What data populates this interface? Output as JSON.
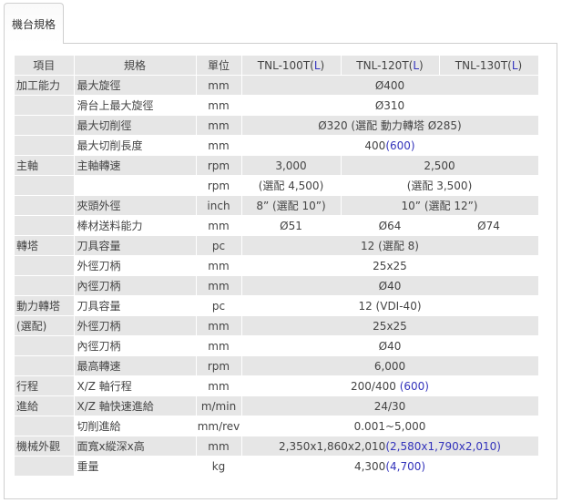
{
  "tab": {
    "label": "機台規格"
  },
  "header": {
    "item": "項目",
    "spec": "規格",
    "unit": "單位",
    "models": [
      {
        "name": "TNL-100T(",
        "accent": "L",
        "close": ")"
      },
      {
        "name": "TNL-120T(",
        "accent": "L",
        "close": ")"
      },
      {
        "name": "TNL-130T(",
        "accent": "L",
        "close": ")"
      }
    ]
  },
  "rows": {
    "r1": {
      "cat": "加工能力",
      "spec": "最大旋徑",
      "unit": "mm",
      "val": "Ø400"
    },
    "r2": {
      "spec": "滑台上最大旋徑",
      "unit": "mm",
      "val": "Ø310"
    },
    "r3": {
      "spec": "最大切削徑",
      "unit": "mm",
      "val": "Ø320 (選配 動力轉塔 Ø285)"
    },
    "r4": {
      "spec": "最大切削長度",
      "unit": "mm",
      "val": "400",
      "extra": "(600)"
    },
    "r5": {
      "cat": "主軸",
      "spec": "主軸轉速",
      "unit": "rpm",
      "v1": "3,000",
      "v23": "2,500"
    },
    "r6": {
      "unit": "rpm",
      "v1": "(選配 4,500)",
      "v23": "(選配 3,500)"
    },
    "r7": {
      "spec": "夾頭外徑",
      "unit": "inch",
      "v1": "8” (選配 10”)",
      "v23": "10” (選配 12”)"
    },
    "r8": {
      "spec": "棒材送料能力",
      "unit": "mm",
      "v1": "Ø51",
      "v2": "Ø64",
      "v3": "Ø74"
    },
    "r9": {
      "cat": "轉塔",
      "spec": "刀具容量",
      "unit": "pc",
      "val": "12 (選配 8)"
    },
    "r10": {
      "spec": "外徑刀柄",
      "unit": "mm",
      "val": "25x25"
    },
    "r11": {
      "spec": "內徑刀柄",
      "unit": "mm",
      "val": "Ø40"
    },
    "r12": {
      "cat": "動力轉塔",
      "spec": "刀具容量",
      "unit": "pc",
      "val": "12 (VDI-40)"
    },
    "r13": {
      "cat": "(選配)",
      "spec": "外徑刀柄",
      "unit": "mm",
      "val": "25x25"
    },
    "r14": {
      "spec": "內徑刀柄",
      "unit": "mm",
      "val": "Ø40"
    },
    "r15": {
      "spec": "最高轉速",
      "unit": "rpm",
      "val": "6,000"
    },
    "r16": {
      "cat": "行程",
      "spec": "X/Z 軸行程",
      "unit": "mm",
      "val": "200/400",
      "extra": "(600)"
    },
    "r17": {
      "cat": "進給",
      "spec": "X/Z 軸快速進給",
      "unit": "m/min",
      "val": "24/30"
    },
    "r18": {
      "spec": "切削進給",
      "unit": "mm/rev",
      "val": "0.001~5,000"
    },
    "r19": {
      "cat": "機械外觀",
      "spec": "面寬x縱深x高",
      "unit": "mm",
      "val": "2,350x1,860x2,010",
      "extra": "(2,580x1,790x2,010)"
    },
    "r20": {
      "spec": "重量",
      "unit": "kg",
      "val": "4,300",
      "extra": "(4,700)"
    }
  }
}
